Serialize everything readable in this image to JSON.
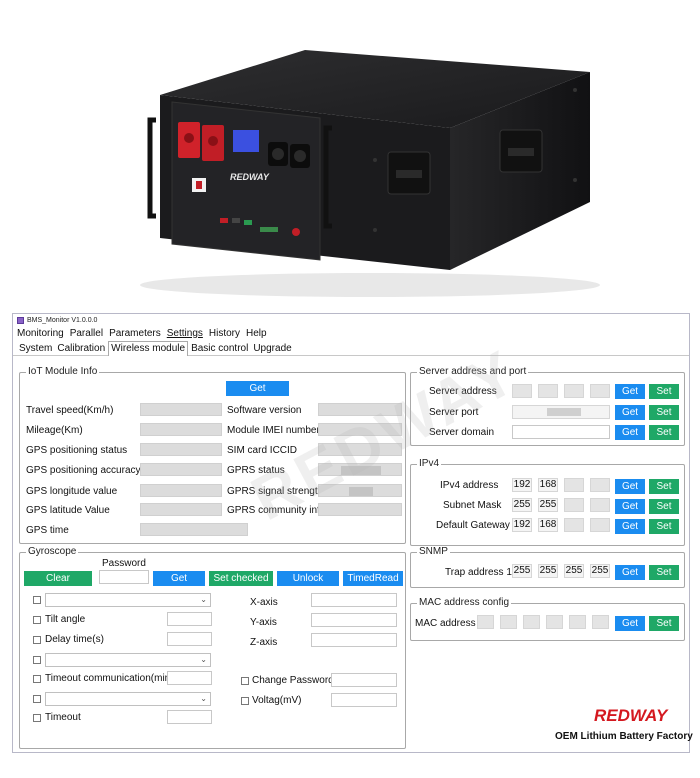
{
  "product": {
    "brand_text": "REDWAY"
  },
  "window": {
    "title": "BMS_Monitor V1.0.0.0"
  },
  "menu": [
    "Monitoring",
    "Parallel",
    "Parameters",
    "Settings",
    "History",
    "Help"
  ],
  "tabs": [
    "System",
    "Calibration",
    "Wireless module",
    "Basic control",
    "Upgrade"
  ],
  "iot": {
    "legend": "IoT Module Info",
    "get_label": "Get",
    "travel_speed": "Travel speed(Km/h)",
    "mileage": "Mileage(Km)",
    "gps_status": "GPS positioning status",
    "gps_accuracy": "GPS positioning accuracy",
    "gps_longitude": "GPS longitude value",
    "gps_latitude": "GPS latitude Value",
    "gps_time": "GPS time",
    "software_version": "Software version",
    "imei": "Module IMEI number",
    "iccid": "SIM card ICCID",
    "gprs_status": "GPRS status",
    "gprs_signal": "GPRS signal strength",
    "gprs_community": "GPRS community info"
  },
  "gyro": {
    "legend": "Gyroscope",
    "password_label": "Password",
    "clear": "Clear",
    "get": "Get",
    "set_checked": "Set checked",
    "unlock": "Unlock",
    "timed_read": "TimedRead",
    "tilt_angle": "Tilt angle",
    "delay_time": "Delay time(s)",
    "timeout_comm": "Timeout communication(min)",
    "timeout": "Timeout",
    "x_axis": "X-axis",
    "y_axis": "Y-axis",
    "z_axis": "Z-axis",
    "change_password": "Change Password",
    "voltage": "Voltag(mV)"
  },
  "server": {
    "legend": "Server address and port",
    "address": "Server address",
    "port": "Server port",
    "domain": "Server domain",
    "get": "Get",
    "set": "Set"
  },
  "ipv4": {
    "legend": "IPv4",
    "address_label": "IPv4 address",
    "address": [
      "192",
      "168",
      "",
      ""
    ],
    "mask_label": "Subnet Mask",
    "mask": [
      "255",
      "255",
      "",
      ""
    ],
    "gateway_label": "Default Gateway",
    "gateway": [
      "192",
      "168",
      "",
      ""
    ],
    "get": "Get",
    "set": "Set"
  },
  "snmp": {
    "legend": "SNMP",
    "trap_label": "Trap address 1",
    "trap": [
      "255",
      "255",
      "255",
      "255"
    ],
    "get": "Get",
    "set": "Set"
  },
  "mac": {
    "legend": "MAC address config",
    "label": "MAC address",
    "get": "Get",
    "set": "Set"
  },
  "watermark": "REDWAY",
  "brand": {
    "logo": "REDWAY",
    "tagline": "OEM Lithium Battery Factory"
  },
  "colors": {
    "button_blue": "#1a8cf0",
    "button_green": "#1fa867",
    "brand_red": "#d4181f"
  }
}
